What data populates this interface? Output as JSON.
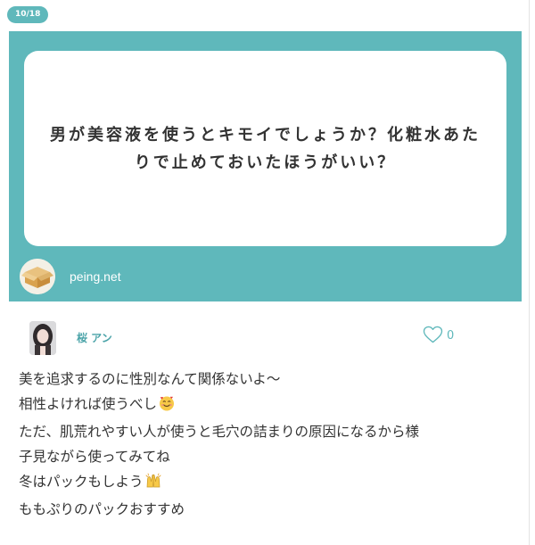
{
  "counter": "10/18",
  "question": {
    "text": "男が美容液を使うとキモイでしょうか？化粧水あたりで止めておいたほうがいい？"
  },
  "site": {
    "name": "peing.net",
    "avatar_icon": "cardboard-box-icon"
  },
  "answer": {
    "author": "桜 アン",
    "likes": "0",
    "like_icon": "heart-outline-icon",
    "lines": [
      {
        "text": "美を追求するのに性別なんて関係ないよ〜",
        "emoji": ""
      },
      {
        "text": "相性よければ使うべし",
        "emoji": "smiling-face-with-hearts-icon"
      },
      {
        "text": "ただ、肌荒れやすい人が使うと毛穴の詰まりの原因になるから様",
        "emoji": ""
      },
      {
        "text": "子見ながら使ってみてね",
        "emoji": ""
      },
      {
        "text": "冬はパックもしよう",
        "emoji": "raising-hands-icon"
      },
      {
        "text": "ももぷりのパックおすすめ",
        "emoji": ""
      }
    ]
  },
  "colors": {
    "brand_teal": "#5fb8bb",
    "name_teal": "#4aa3a8",
    "text": "#333333"
  }
}
